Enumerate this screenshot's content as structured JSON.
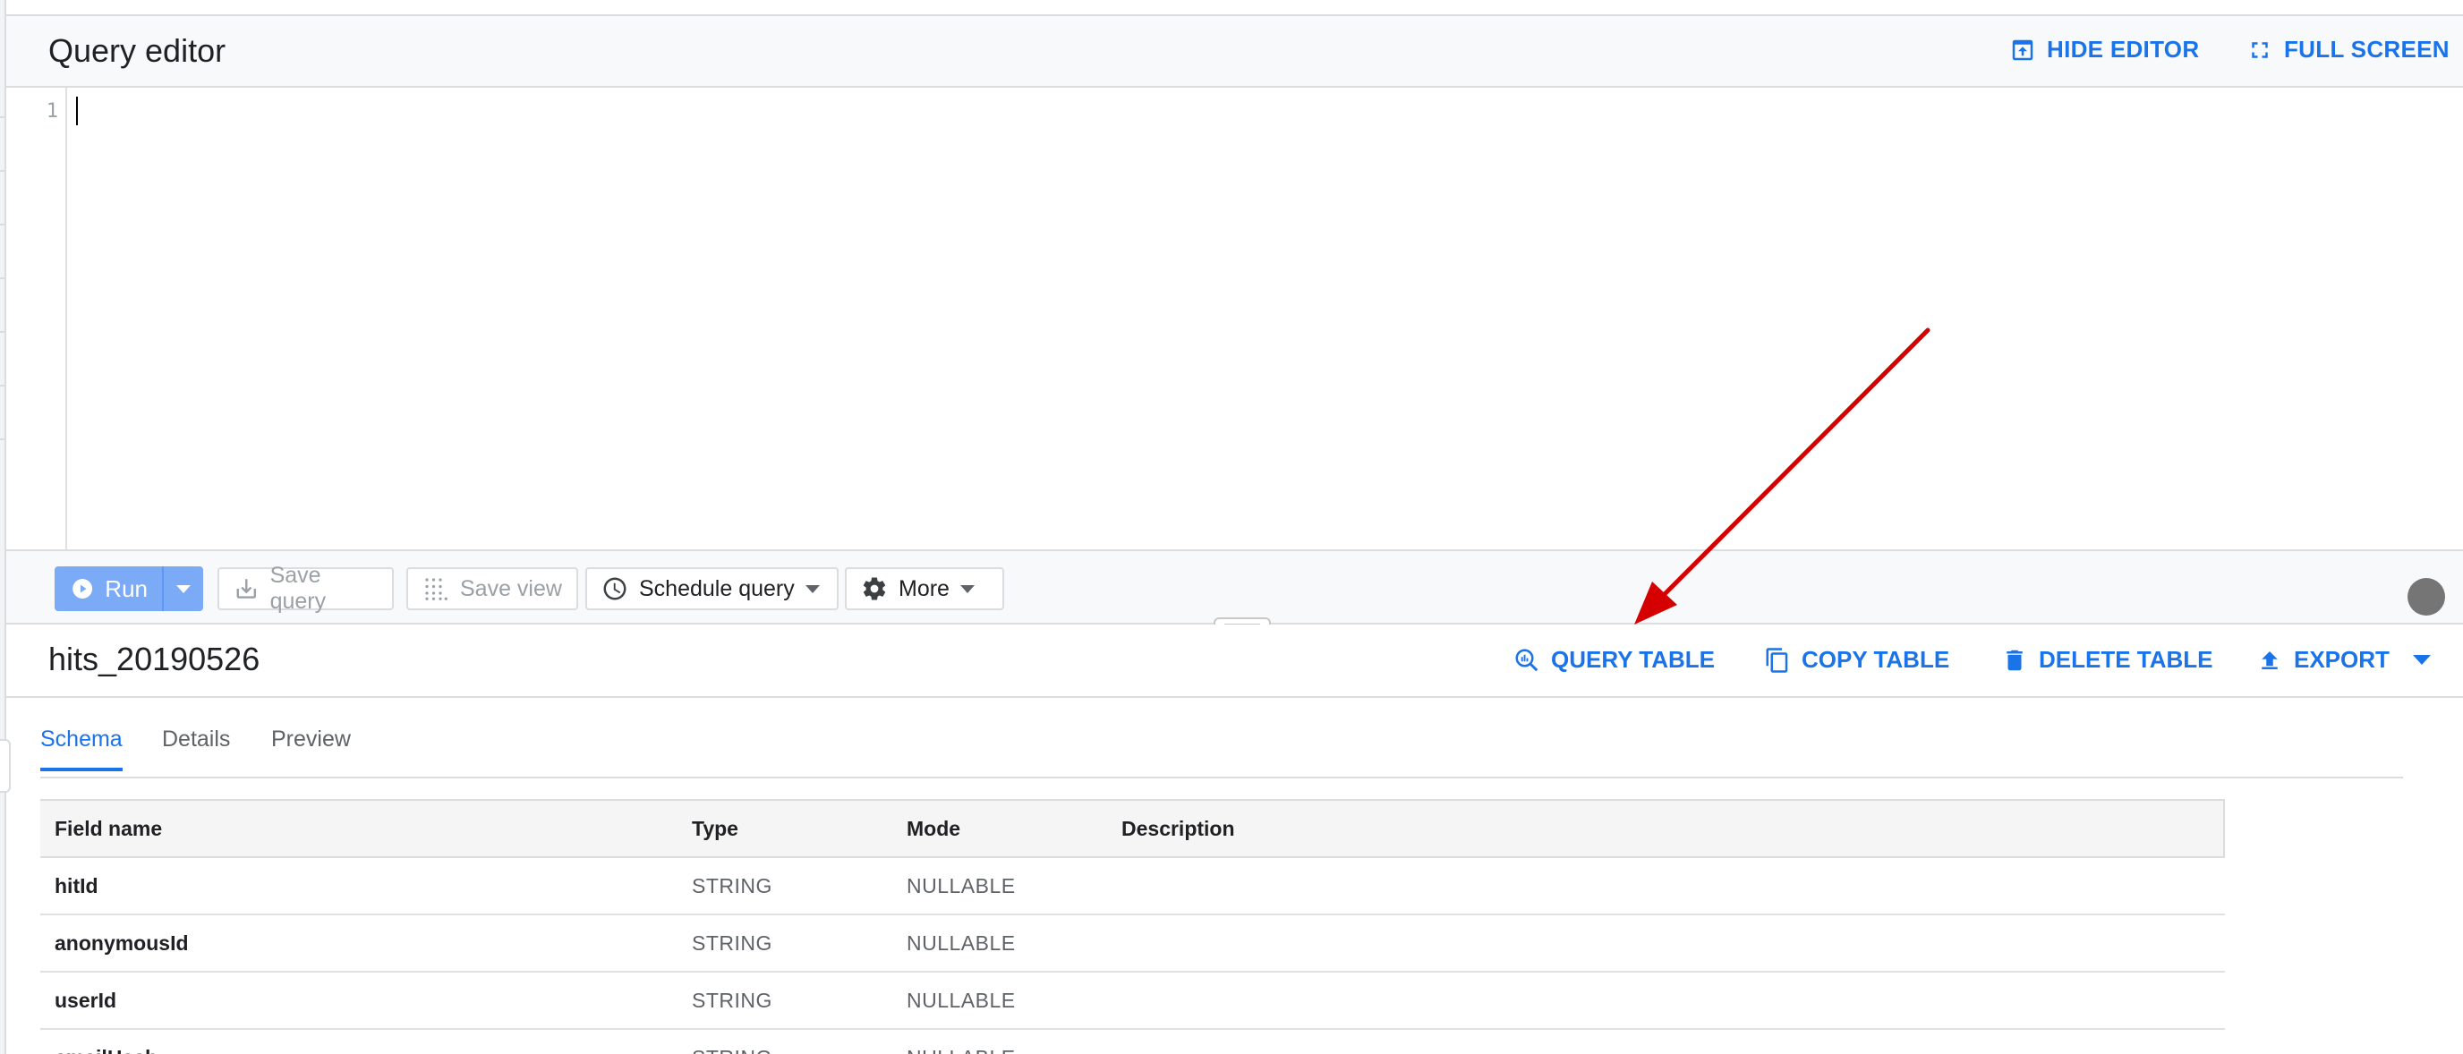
{
  "editor": {
    "title": "Query editor",
    "hide_editor_label": "HIDE EDITOR",
    "full_screen_label": "FULL SCREEN",
    "line_numbers": [
      "1"
    ],
    "content": ""
  },
  "toolbar": {
    "run_label": "Run",
    "save_query_label": "Save query",
    "save_view_label": "Save view",
    "schedule_query_label": "Schedule query",
    "more_label": "More"
  },
  "table": {
    "name": "hits_20190526",
    "actions": {
      "query_table": "QUERY TABLE",
      "copy_table": "COPY TABLE",
      "delete_table": "DELETE TABLE",
      "export": "EXPORT"
    },
    "tabs": [
      "Schema",
      "Details",
      "Preview"
    ],
    "active_tab": "Schema",
    "schema_columns": [
      "Field name",
      "Type",
      "Mode",
      "Description"
    ],
    "schema_rows": [
      {
        "name": "hitId",
        "type": "STRING",
        "mode": "NULLABLE",
        "description": ""
      },
      {
        "name": "anonymousId",
        "type": "STRING",
        "mode": "NULLABLE",
        "description": ""
      },
      {
        "name": "userId",
        "type": "STRING",
        "mode": "NULLABLE",
        "description": ""
      },
      {
        "name": "emailHash",
        "type": "STRING",
        "mode": "NULLABLE",
        "description": ""
      }
    ]
  },
  "colors": {
    "accent": "#1a73e8",
    "run_button": "#7baaf7",
    "annotation_arrow": "#d50000",
    "status_dot": "#757575"
  },
  "icons": {
    "hide_editor": "hide-editor-icon",
    "full_screen": "fullscreen-icon",
    "run": "play-icon",
    "save_query": "download-icon",
    "save_view": "grid-dots-icon",
    "schedule_query": "clock-icon",
    "more": "gear-icon",
    "query_table": "query-table-icon",
    "copy_table": "copy-icon",
    "delete_table": "trash-icon",
    "export": "upload-icon"
  }
}
